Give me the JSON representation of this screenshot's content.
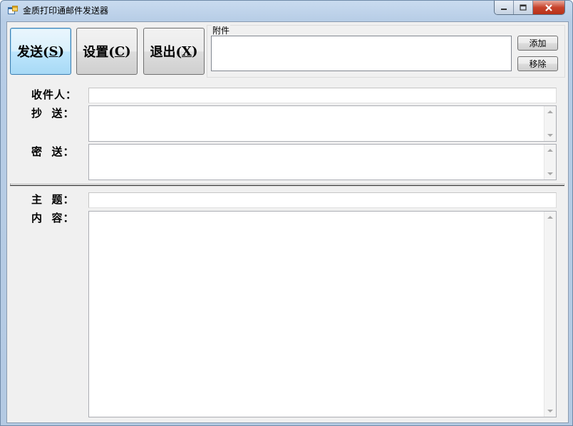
{
  "window": {
    "title": "金质打印通邮件发送器",
    "icon": "app-window-icon"
  },
  "toolbar": {
    "send": {
      "text": "发送(",
      "key": "S",
      "end": ")"
    },
    "settings": {
      "text": "设置(",
      "key": "C",
      "end": ")"
    },
    "exit": {
      "text": "退出(",
      "key": "X",
      "end": ")"
    }
  },
  "attachments": {
    "label": "附件",
    "add_label": "添加",
    "remove_label": "移除"
  },
  "form": {
    "to_label": "收件人：",
    "cc_label": "抄  送：",
    "bcc_label": "密  送：",
    "subject_label": "主  题：",
    "content_label": "内  容：",
    "to_value": "",
    "cc_value": "",
    "bcc_value": "",
    "subject_value": "",
    "content_value": ""
  },
  "colors": {
    "title_bar": "#b7cde6",
    "client_bg": "#f0f0f0",
    "focus_border": "#3c7fb1",
    "close_button": "#c7432c"
  }
}
